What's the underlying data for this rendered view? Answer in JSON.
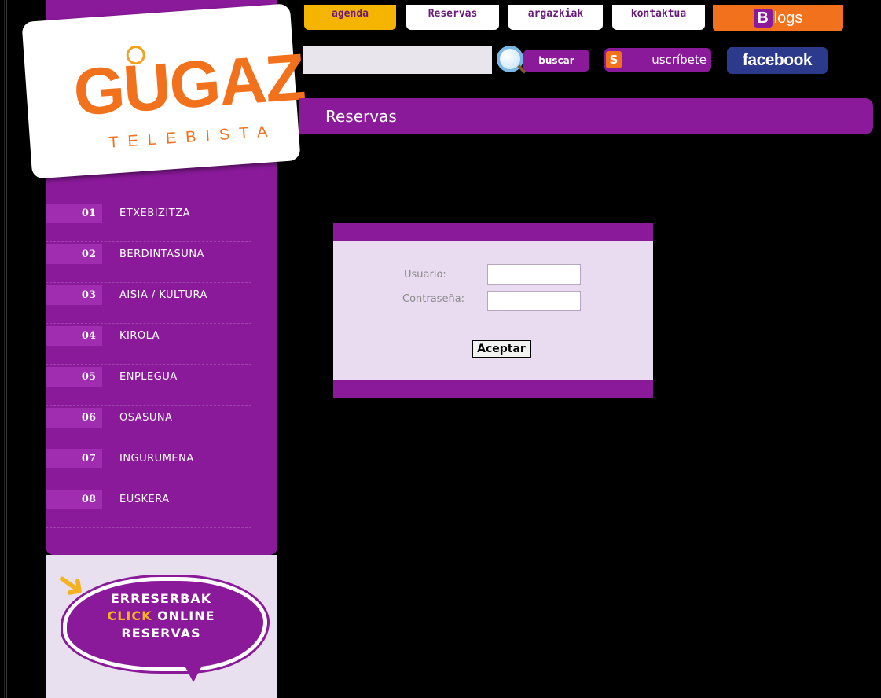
{
  "logo": {
    "name": "GUGAZ",
    "subtitle": "TELEBISTA"
  },
  "top_nav": {
    "tabs": [
      {
        "label": "agenda"
      },
      {
        "label": "Reservas"
      },
      {
        "label": "argazkiak"
      },
      {
        "label": "kontaktua"
      }
    ],
    "blogs": {
      "b": "B",
      "label": "logs"
    }
  },
  "search": {
    "placeholder": "",
    "button_label": "buscar"
  },
  "subscribe": {
    "s": "S",
    "label": "uscríbete"
  },
  "facebook": {
    "label": "facebook"
  },
  "page_title": "Reservas",
  "sidebar": {
    "items": [
      {
        "num": "01",
        "label": "ETXEBIZITZA"
      },
      {
        "num": "02",
        "label": "BERDINTASUNA"
      },
      {
        "num": "03",
        "label": "AISIA / KULTURA"
      },
      {
        "num": "04",
        "label": "KIROLA"
      },
      {
        "num": "05",
        "label": "ENPLEGUA"
      },
      {
        "num": "06",
        "label": "OSASUNA"
      },
      {
        "num": "07",
        "label": "INGURUMENA"
      },
      {
        "num": "08",
        "label": "EUSKERA"
      }
    ]
  },
  "promo": {
    "line1": "ERRESERBAK",
    "click": "CLICK",
    "online": "ONLINE",
    "line3": "RESERVAS"
  },
  "login": {
    "user_label": "Usuario:",
    "password_label": "Contraseña:",
    "user_value": "",
    "password_value": "",
    "submit_label": "Aceptar"
  },
  "colors": {
    "brand_purple": "#8a1a9a",
    "brand_orange": "#f2711c",
    "agenda_yellow": "#f5b400",
    "panel_bg": "#eadcf0"
  }
}
